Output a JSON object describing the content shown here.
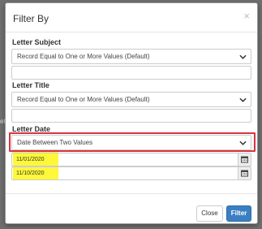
{
  "modal": {
    "title": "Filter By",
    "close_glyph": "×"
  },
  "letter_subject": {
    "label": "Letter Subject",
    "select_value": "Record Equal to One or More Values (Default)",
    "input_value": ""
  },
  "letter_title": {
    "label": "Letter Title",
    "select_value": "Record Equal to One or More Values (Default)",
    "input_value": ""
  },
  "letter_date": {
    "label": "Letter Date",
    "select_value": "Date Between Two Values",
    "start_date": "11/01/2020",
    "end_date": "11/10/2020"
  },
  "footer": {
    "close_label": "Close",
    "filter_label": "Filter"
  },
  "icons": {
    "dropdown": "chevron-down-icon",
    "calendar": "calendar-icon",
    "close": "close-icon"
  },
  "colors": {
    "highlight_border": "#d9343f",
    "date_highlight": "#fff83a",
    "primary_button": "#3a7fc1"
  }
}
